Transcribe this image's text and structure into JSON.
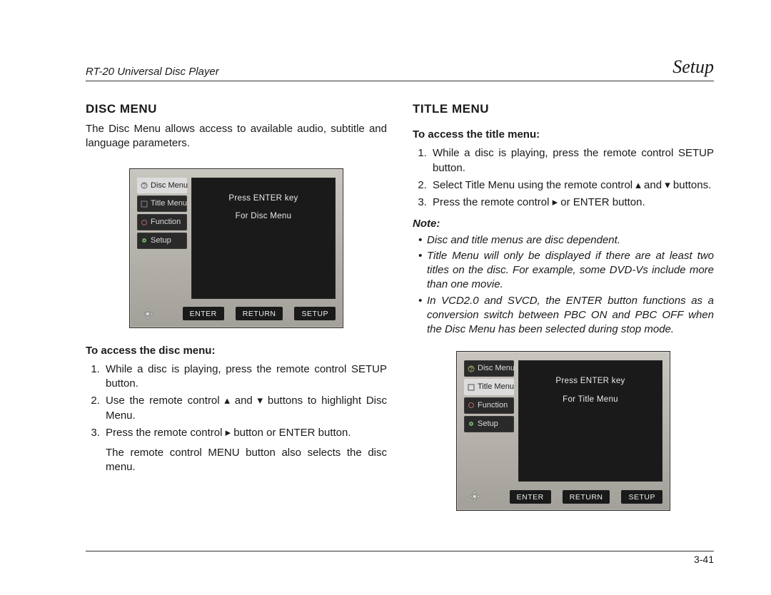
{
  "header": {
    "product": "RT-20 Universal Disc Player",
    "section": "Setup"
  },
  "left": {
    "heading": "DISC MENU",
    "intro": "The Disc Menu allows access to available audio, subtitle and language parameters.",
    "access_head": "To access the disc menu:",
    "steps": [
      "While a disc is playing, press the remote control SETUP button.",
      "Use the remote control ▴ and ▾ buttons to highlight Disc Menu.",
      "Press the remote control ▸ button or ENTER button."
    ],
    "trailing": "The remote control MENU button also selects the disc menu.",
    "screen": {
      "line1": "Press ENTER key",
      "line2": "For Disc Menu",
      "active_tab": "Disc Menu",
      "tabs": [
        "Disc Menu",
        "Title Menu",
        "Function",
        "Setup"
      ],
      "chips": [
        "ENTER",
        "RETURN",
        "SETUP"
      ]
    }
  },
  "right": {
    "heading": "TITLE MENU",
    "access_head": "To access the title menu:",
    "steps": [
      "While a disc is playing, press the remote control SETUP button.",
      "Select Title Menu using the remote control ▴ and ▾ buttons.",
      "Press the remote control ▸ or ENTER  button."
    ],
    "note_label": "Note:",
    "notes": [
      "Disc and title menus are disc dependent.",
      "Title Menu will only be displayed if there are at least two titles on the disc. For example, some DVD-Vs include more than one movie.",
      "In VCD2.0 and SVCD, the ENTER button functions as a conversion switch between PBC ON and PBC OFF when the Disc Menu has been selected during stop mode."
    ],
    "screen": {
      "line1": "Press ENTER key",
      "line2": "For Title Menu",
      "active_tab": "Title Menu",
      "tabs": [
        "Disc Menu",
        "Title Menu",
        "Function",
        "Setup"
      ],
      "chips": [
        "ENTER",
        "RETURN",
        "SETUP"
      ]
    }
  },
  "page_number": "3-41"
}
